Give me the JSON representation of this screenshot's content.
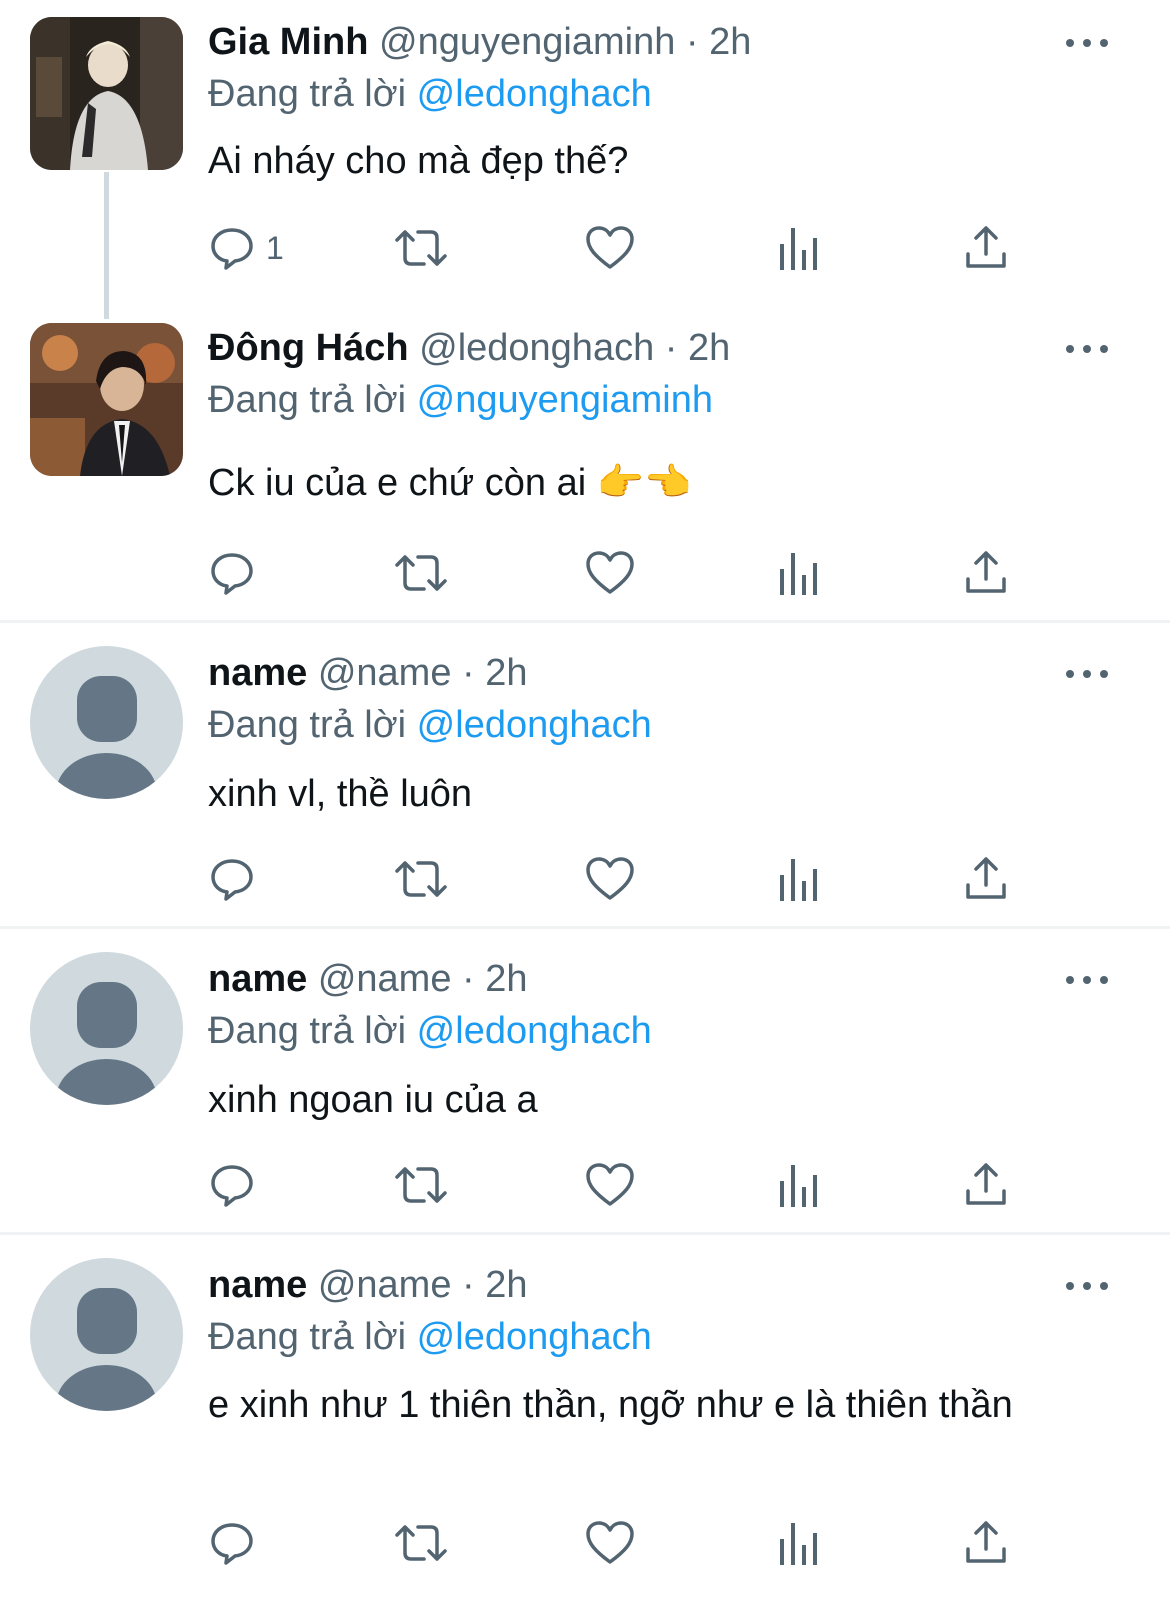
{
  "colors": {
    "text": "#0f1419",
    "muted": "#536471",
    "link": "#1d9bf0",
    "avatar_bg": "#cfd9de",
    "avatar_fg": "#657786"
  },
  "icons": {
    "reply": "reply-icon",
    "retweet": "retweet-icon",
    "like": "heart-icon",
    "views": "analytics-icon",
    "share": "share-icon",
    "more": "more-options-icon"
  },
  "replying_label": "Đang trả lời",
  "tweets": [
    {
      "name": "Gia Minh",
      "handle": "@nguyengiaminh",
      "dot": "·",
      "time": "2h",
      "mention": "@ledonghach",
      "text": "Ai nháy cho mà đẹp thế?",
      "reply_count": "1"
    },
    {
      "name": "Đông Hách",
      "handle": "@ledonghach",
      "dot": "·",
      "time": "2h",
      "mention": "@nguyengiaminh",
      "text": "Ck iu của e chứ còn ai 👉👈",
      "reply_count": ""
    },
    {
      "name": "name",
      "handle": "@name",
      "dot": "·",
      "time": "2h",
      "mention": "@ledonghach",
      "text": "xinh vl, thề luôn",
      "reply_count": ""
    },
    {
      "name": "name",
      "handle": "@name",
      "dot": "·",
      "time": "2h",
      "mention": "@ledonghach",
      "text": "xinh ngoan iu của a",
      "reply_count": ""
    },
    {
      "name": "name",
      "handle": "@name",
      "dot": "·",
      "time": "2h",
      "mention": "@ledonghach",
      "text": "e xinh như 1 thiên thần, ngỡ như e là thiên thần",
      "reply_count": ""
    }
  ]
}
